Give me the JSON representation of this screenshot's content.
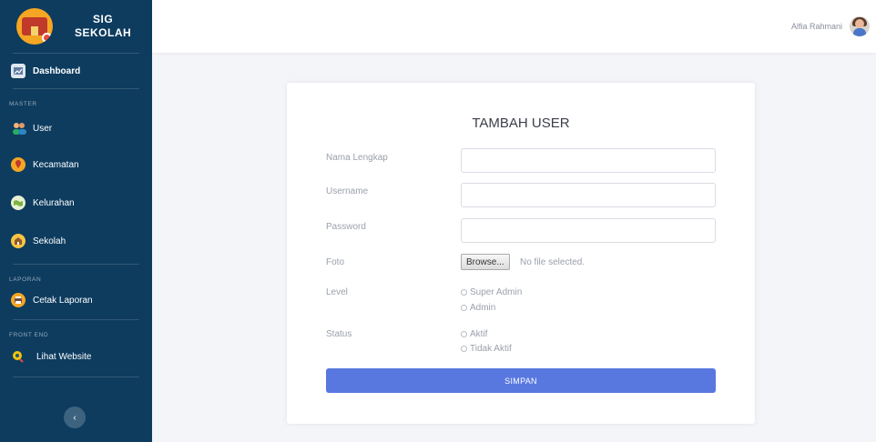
{
  "brand": {
    "line1": "SIG",
    "line2": "SEKOLAH",
    "logo_icon": "school-logo-icon"
  },
  "sidebar": {
    "dashboard": {
      "label": "Dashboard",
      "icon": "dashboard-icon"
    },
    "sections": {
      "master": "MASTER",
      "laporan": "LAPORAN",
      "front_end": "FRONT END"
    },
    "items": [
      {
        "label": "User",
        "icon": "users-icon"
      },
      {
        "label": "Kecamatan",
        "icon": "location-icon"
      },
      {
        "label": "Kelurahan",
        "icon": "map-icon"
      },
      {
        "label": "Sekolah",
        "icon": "school-icon"
      },
      {
        "label": "Cetak Laporan",
        "icon": "printer-icon"
      },
      {
        "label": "Lihat Website",
        "icon": "view-icon"
      }
    ],
    "collapse_symbol": "‹"
  },
  "topbar": {
    "user_name": "Alfia Rahmani"
  },
  "form": {
    "title": "TAMBAH USER",
    "fields": {
      "nama": {
        "label": "Nama Lengkap",
        "value": "",
        "placeholder": ""
      },
      "username": {
        "label": "Username",
        "value": "",
        "placeholder": ""
      },
      "password": {
        "label": "Password",
        "value": "",
        "placeholder": ""
      },
      "foto": {
        "label": "Foto",
        "button": "Browse...",
        "status": "No file selected."
      },
      "level": {
        "label": "Level",
        "options": [
          "Super Admin",
          "Admin"
        ]
      },
      "status": {
        "label": "Status",
        "options": [
          "Aktif",
          "Tidak Aktif"
        ]
      }
    },
    "submit_label": "SIMPAN"
  },
  "colors": {
    "sidebar_bg": "#0d3c5f",
    "accent": "#5878e0",
    "page_bg": "#f4f5f9"
  }
}
